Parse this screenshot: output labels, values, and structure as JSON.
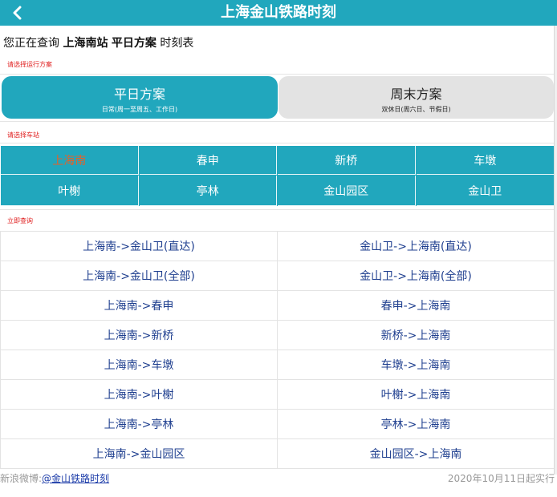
{
  "header": {
    "title": "上海金山铁路时刻",
    "back_icon": "chevron-left-icon",
    "color": "#21a7bd"
  },
  "query": {
    "prefix": "您正在查询",
    "station": "上海南站",
    "plan": "平日方案",
    "suffix": "时刻表"
  },
  "hints": {
    "plan": "请选择运行方案",
    "station": "请选择车站",
    "query": "立即查询"
  },
  "plans": [
    {
      "title": "平日方案",
      "subtitle": "日常(周一至周五、工作日)",
      "active": true
    },
    {
      "title": "周末方案",
      "subtitle": "双休日(周六日、节假日)",
      "active": false
    }
  ],
  "stations": [
    "上海南",
    "春申",
    "新桥",
    "车墩",
    "叶榭",
    "亭林",
    "金山园区",
    "金山卫"
  ],
  "selected_station_color": "#e2622a",
  "routes": [
    [
      "上海南->金山卫(直达)",
      "金山卫->上海南(直达)"
    ],
    [
      "上海南->金山卫(全部)",
      "金山卫->上海南(全部)"
    ],
    [
      "上海南->春申",
      "春申->上海南"
    ],
    [
      "上海南->新桥",
      "新桥->上海南"
    ],
    [
      "上海南->车墩",
      "车墩->上海南"
    ],
    [
      "上海南->叶榭",
      "叶榭->上海南"
    ],
    [
      "上海南->亭林",
      "亭林->上海南"
    ],
    [
      "上海南->金山园区",
      "金山园区->上海南"
    ]
  ],
  "footer": {
    "weibo_label": "新浪微博:",
    "weibo_link": "@金山铁路时刻",
    "effective": "2020年10月11日起实行"
  }
}
